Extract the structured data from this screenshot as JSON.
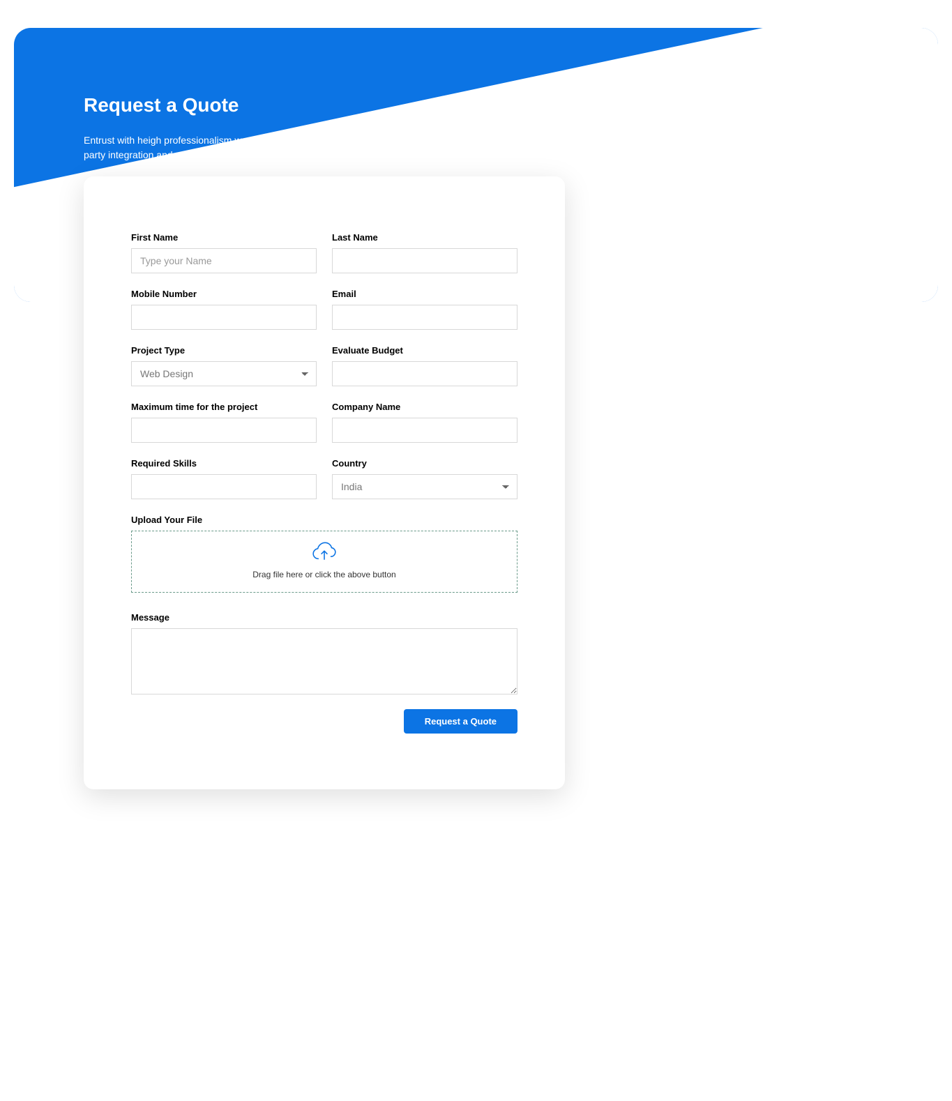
{
  "header": {
    "title": "Request a Quote",
    "description": "Entrust with heigh professionalism we are offering pixel perfect web and mobile application development third party integration and solution to our."
  },
  "form": {
    "first_name": {
      "label": "First Name",
      "placeholder": "Type your Name",
      "value": ""
    },
    "last_name": {
      "label": "Last Name",
      "placeholder": "",
      "value": ""
    },
    "mobile": {
      "label": "Mobile Number",
      "placeholder": "",
      "value": ""
    },
    "email": {
      "label": "Email",
      "placeholder": "",
      "value": ""
    },
    "project_type": {
      "label": "Project Type",
      "selected": "Web Design"
    },
    "budget": {
      "label": "Evaluate Budget",
      "placeholder": "",
      "value": ""
    },
    "max_time": {
      "label": "Maximum time for the project",
      "placeholder": "",
      "value": ""
    },
    "company": {
      "label": "Company Name",
      "placeholder": "",
      "value": ""
    },
    "skills": {
      "label": "Required Skills",
      "placeholder": "",
      "value": ""
    },
    "country": {
      "label": "Country",
      "selected": "India"
    },
    "upload": {
      "label": "Upload Your File",
      "hint": "Drag file here or click the above button"
    },
    "message": {
      "label": "Message",
      "placeholder": "",
      "value": ""
    },
    "submit_label": "Request a Quote"
  }
}
